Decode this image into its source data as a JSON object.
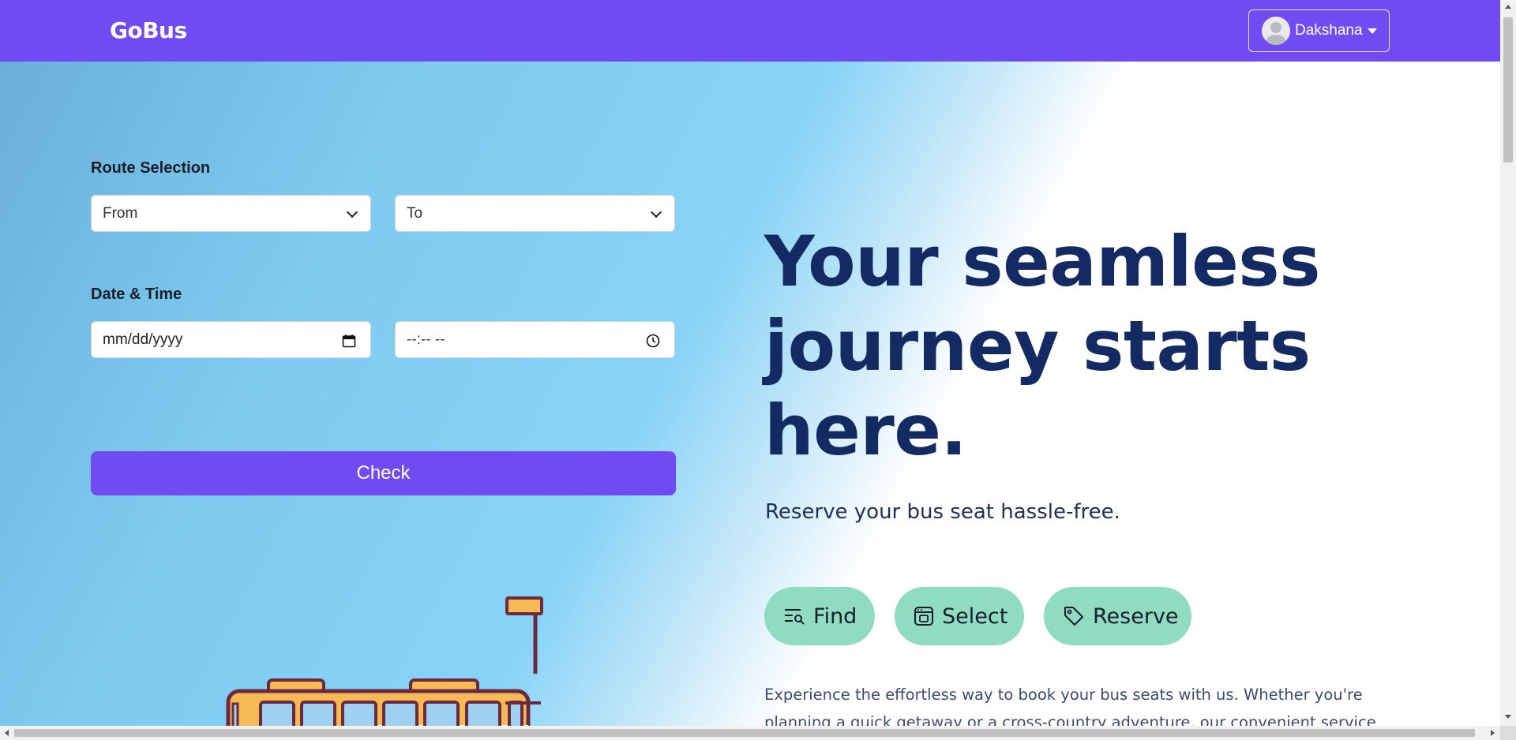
{
  "navbar": {
    "brand": "GoBus",
    "user_name": "Dakshana"
  },
  "route": {
    "label": "Route Selection",
    "from_value": "From",
    "to_value": "To"
  },
  "datetime": {
    "label": "Date & Time",
    "date_placeholder": "mm/dd/yyyy",
    "time_placeholder": "--:-- --"
  },
  "check_button": "Check",
  "hero": {
    "headline": "Your seamless journey starts here.",
    "subheadline": "Reserve your bus seat hassle-free.",
    "pills": [
      {
        "label": "Find",
        "icon": "search-list-icon"
      },
      {
        "label": "Select",
        "icon": "seat-window-icon"
      },
      {
        "label": "Reserve",
        "icon": "tag-icon"
      }
    ],
    "paragraph": "Experience the effortless way to book your bus seats with us. Whether you're planning a quick getaway or a cross-country adventure, our convenient service puts you in control of your journey, every step of the way."
  },
  "colors": {
    "brand": "#714bf2",
    "heading": "#132a63",
    "pill": "#8fdcc0"
  }
}
